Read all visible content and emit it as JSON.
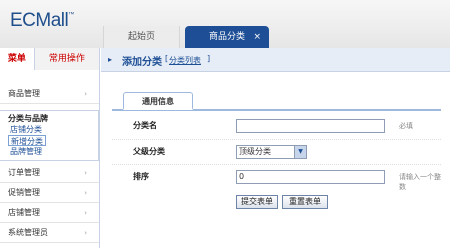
{
  "header": {
    "logo": "ECMall",
    "logo_tm": "™",
    "tabs": [
      {
        "label": "起始页"
      },
      {
        "label": "商品分类",
        "close": "×"
      }
    ]
  },
  "sidebar": {
    "tabs": [
      {
        "label": "菜单"
      },
      {
        "label": "常用操作"
      }
    ],
    "groups": [
      {
        "label": "商品管理",
        "arrow": "›"
      },
      {
        "label": "订单管理",
        "arrow": "›"
      },
      {
        "label": "促销管理",
        "arrow": "›"
      },
      {
        "label": "店铺管理",
        "arrow": "›"
      },
      {
        "label": "系统管理员",
        "arrow": "›"
      }
    ],
    "open_group": {
      "title": "分类与品牌",
      "items": [
        {
          "label": "店铺分类"
        },
        {
          "label": "新增分类"
        },
        {
          "label": "品牌管理"
        }
      ]
    }
  },
  "main": {
    "bullet": "▸",
    "title": "添加分类",
    "list_link": "分类列表",
    "lb": "[",
    "rb": "]",
    "form_tab": "通用信息",
    "fields": {
      "name": {
        "label": "分类名",
        "value": "",
        "hint": "必填"
      },
      "parent": {
        "label": "父级分类",
        "value": "顶级分类"
      },
      "sort": {
        "label": "排序",
        "value": "0",
        "hint": "请输入一个整数"
      }
    },
    "buttons": {
      "submit": "提交表单",
      "reset": "重置表单"
    }
  }
}
